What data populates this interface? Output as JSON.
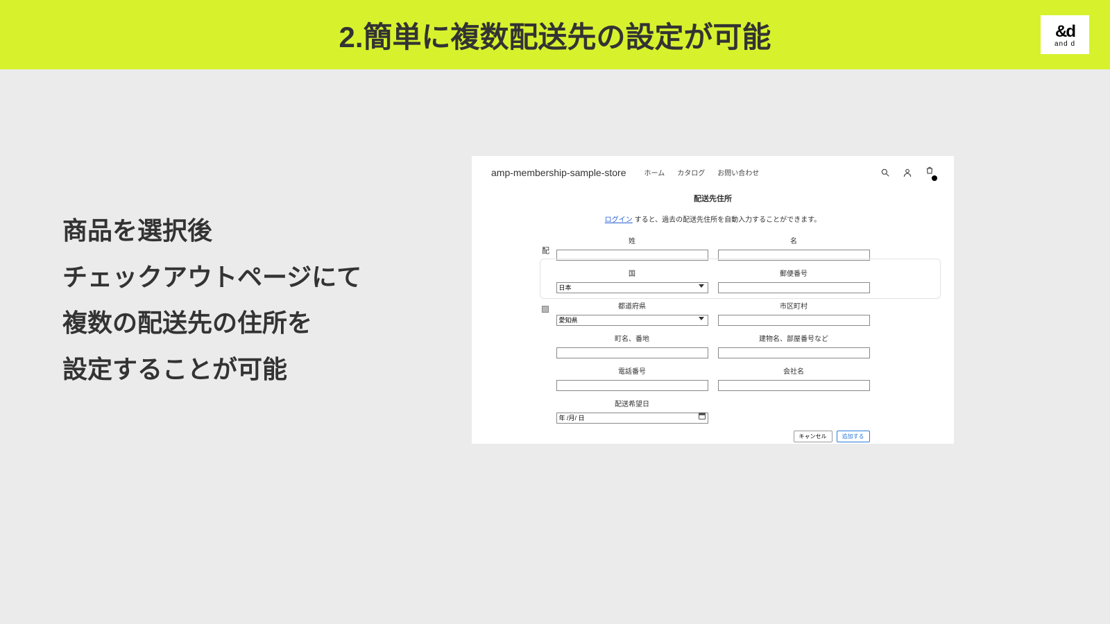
{
  "header": {
    "title": "2.簡単に複数配送先の設定が可能",
    "logo_top": "&d",
    "logo_bottom": "and d"
  },
  "description": {
    "line1": "商品を選択後",
    "line2": "チェックアウトページにて",
    "line3": "複数の配送先の住所を",
    "line4": "設定することが可能"
  },
  "screenshot": {
    "store_name": "amp-membership-sample-store",
    "nav": {
      "home": "ホーム",
      "catalog": "カタログ",
      "contact": "お問い合わせ"
    },
    "side_label": "配",
    "panel": {
      "title": "配送先住所",
      "login_link": "ログイン",
      "login_rest": " すると、過去の配送先住所を自動入力することができます。",
      "labels": {
        "last_name": "姓",
        "first_name": "名",
        "country": "国",
        "postal": "郵便番号",
        "prefecture": "都道府県",
        "city": "市区町村",
        "street": "町名、番地",
        "building": "建物名、部屋番号など",
        "phone": "電話番号",
        "company": "会社名",
        "desired_date": "配送希望日"
      },
      "country_value": "日本",
      "prefecture_value": "愛知県",
      "date_placeholder": "年 /月/ 日",
      "cancel": "キャンセル",
      "submit": "追加する"
    }
  }
}
